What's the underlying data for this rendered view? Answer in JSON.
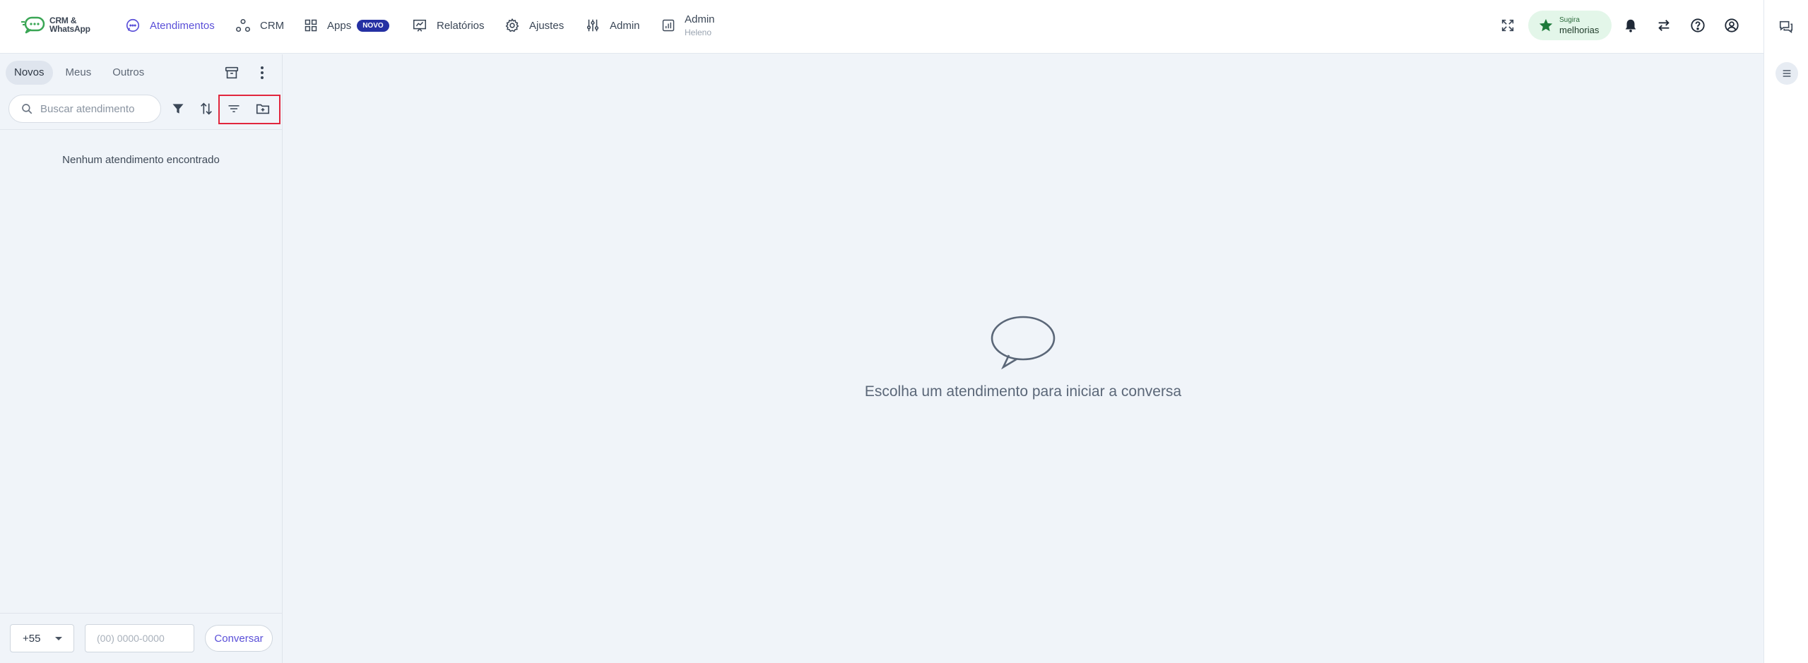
{
  "app": {
    "logo_line1": "CRM &",
    "logo_line2": "WhatsApp",
    "brand_color": "#3aa655",
    "accent_color": "#5a4fd8"
  },
  "nav": {
    "atendimentos": "Atendimentos",
    "crm": "CRM",
    "apps": "Apps",
    "apps_badge": "NOVO",
    "relatorios": "Relatórios",
    "ajustes": "Ajustes",
    "admin": "Admin",
    "admin_user_label": "Admin",
    "admin_user_name": "Heleno"
  },
  "header_actions": {
    "suggest_line1": "Sugira",
    "suggest_line2": "melhorias",
    "icons": [
      "fullscreen-icon",
      "star-icon",
      "bell-icon",
      "swap-icon",
      "help-icon",
      "user-icon"
    ]
  },
  "sidebar": {
    "tabs": [
      {
        "label": "Novos",
        "active": true
      },
      {
        "label": "Meus",
        "active": false
      },
      {
        "label": "Outros",
        "active": false
      }
    ],
    "search_placeholder": "Buscar atendimento",
    "empty_message": "Nenhum atendimento encontrado",
    "country_code": "+55",
    "phone_placeholder": "(00) 0000-0000",
    "converse_label": "Conversar"
  },
  "main": {
    "empty_title": "Escolha um atendimento para iniciar a conversa"
  }
}
